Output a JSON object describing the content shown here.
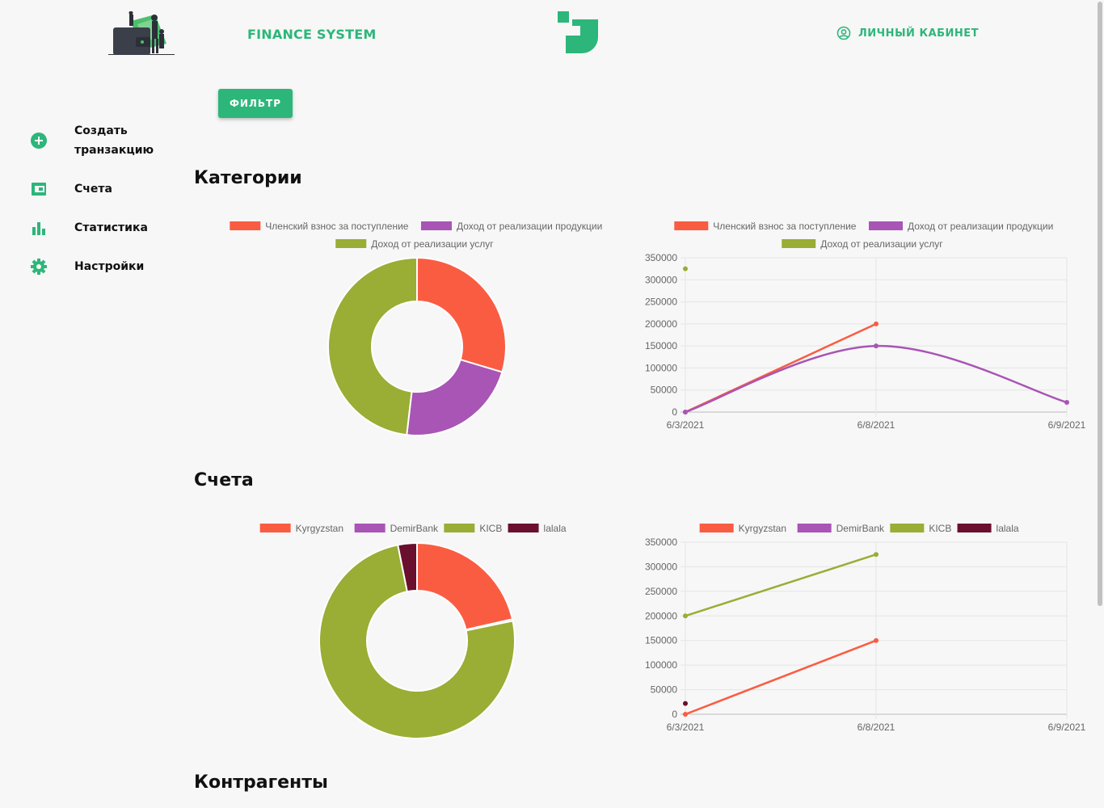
{
  "header": {
    "brand": "FINANCE SYSTEM",
    "account_label": "ЛИЧНЫЙ КАБИНЕТ",
    "accent_color": "#2db67a"
  },
  "toolbar": {
    "filter_label": "ФИЛЬТР"
  },
  "sidebar": {
    "items": [
      {
        "label": "Создать транзакцию",
        "icon": "plus-circle-icon"
      },
      {
        "label": "Счета",
        "icon": "wallet-icon"
      },
      {
        "label": "Статистика",
        "icon": "bar-chart-icon"
      },
      {
        "label": "Настройки",
        "icon": "gear-icon"
      }
    ]
  },
  "sections": {
    "categories": "Категории",
    "accounts": "Счета",
    "counterparties": "Контрагенты"
  },
  "chart_data": [
    {
      "type": "doughnut",
      "legend": [
        "Членский взнос за поступление",
        "Доход от реализации продукции",
        "Доход от реализации услуг"
      ],
      "colors": [
        "#fa5c42",
        "#a855b5",
        "#9aad35"
      ],
      "values": [
        200000,
        150000,
        325000
      ]
    },
    {
      "type": "line",
      "legend": [
        "Членский взнос за поступление",
        "Доход от реализации продукции",
        "Доход от реализации услуг"
      ],
      "colors": [
        "#fa5c42",
        "#a855b5",
        "#9aad35"
      ],
      "x": [
        "6/3/2021",
        "6/8/2021",
        "6/9/2021"
      ],
      "series": [
        {
          "name": "Членский взнос за поступление",
          "values": [
            0,
            200000,
            null
          ]
        },
        {
          "name": "Доход от реализации продукции",
          "values": [
            0,
            150000,
            22000
          ]
        },
        {
          "name": "Доход от реализации услуг",
          "values": [
            325000,
            null,
            null
          ]
        }
      ],
      "ylim": [
        0,
        350000
      ],
      "yticks": [
        "350000",
        "300000",
        "250000",
        "200000",
        "150000",
        "100000",
        "50000",
        "0"
      ],
      "smooth": true
    },
    {
      "type": "doughnut",
      "legend": [
        "Kyrgyzstan",
        "DemirBank",
        "KICB",
        "lalala"
      ],
      "colors": [
        "#fa5c42",
        "#a855b5",
        "#9aad35",
        "#6b0f2e"
      ],
      "values": [
        150000,
        2000,
        525000,
        22000
      ]
    },
    {
      "type": "line",
      "legend": [
        "Kyrgyzstan",
        "DemirBank",
        "KICB",
        "lalala"
      ],
      "colors": [
        "#fa5c42",
        "#a855b5",
        "#9aad35",
        "#6b0f2e"
      ],
      "x": [
        "6/3/2021",
        "6/8/2021",
        "6/9/2021"
      ],
      "series": [
        {
          "name": "Kyrgyzstan",
          "values": [
            0,
            150000,
            null
          ]
        },
        {
          "name": "DemirBank",
          "values": [
            null,
            null,
            null
          ]
        },
        {
          "name": "KICB",
          "values": [
            200000,
            325000,
            null
          ]
        },
        {
          "name": "lalala",
          "values": [
            22000,
            null,
            null
          ]
        }
      ],
      "ylim": [
        0,
        350000
      ],
      "yticks": [
        "350000",
        "300000",
        "250000",
        "200000",
        "150000",
        "100000",
        "50000",
        "0"
      ],
      "smooth": false
    }
  ]
}
